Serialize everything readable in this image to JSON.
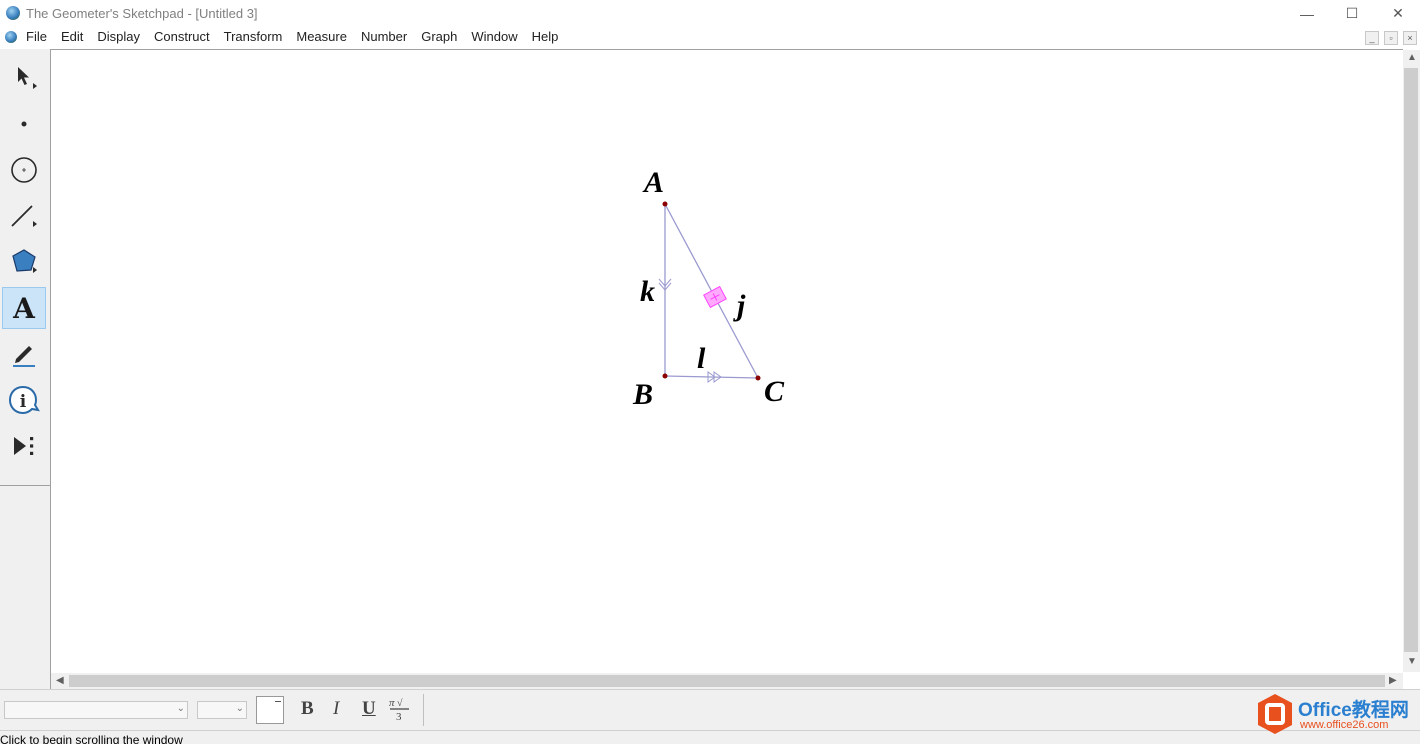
{
  "window": {
    "title": "The Geometer's Sketchpad - [Untitled 3]",
    "controls": [
      "—",
      "☐",
      "✕"
    ]
  },
  "menu": {
    "items": [
      "File",
      "Edit",
      "Display",
      "Construct",
      "Transform",
      "Measure",
      "Number",
      "Graph",
      "Window",
      "Help"
    ]
  },
  "mdi_controls": [
    "_",
    "▫",
    "×"
  ],
  "toolbox": {
    "tools": [
      {
        "name": "selection-arrow-tool",
        "icon": "arrow-icon"
      },
      {
        "name": "point-tool",
        "icon": "point-icon"
      },
      {
        "name": "compass-tool",
        "icon": "circle-icon"
      },
      {
        "name": "straightedge-tool",
        "icon": "segment-icon"
      },
      {
        "name": "polygon-tool",
        "icon": "polygon-icon"
      },
      {
        "name": "text-tool",
        "icon": "text-a-icon",
        "label": "A",
        "active": true
      },
      {
        "name": "marker-tool",
        "icon": "pen-icon"
      },
      {
        "name": "information-tool",
        "icon": "info-icon",
        "label": "i"
      },
      {
        "name": "custom-tool",
        "icon": "play-menu-icon"
      }
    ]
  },
  "sketch": {
    "points": [
      {
        "label": "A"
      },
      {
        "label": "B"
      },
      {
        "label": "C"
      }
    ],
    "segments": [
      {
        "label": "k"
      },
      {
        "label": "j"
      },
      {
        "label": "l"
      }
    ],
    "colors": {
      "segment": "#9a9ad0",
      "point": "#8b0000",
      "marker": "#ff66ff"
    }
  },
  "text_toolbar": {
    "font_value": "",
    "size_value": "",
    "bold": "B",
    "italic": "I",
    "underline": "U",
    "math_format": "math-format-icon"
  },
  "status": {
    "text": "Click to begin scrolling the window"
  },
  "watermark": {
    "brand": "Office教程网",
    "url": "www.office26.com"
  }
}
